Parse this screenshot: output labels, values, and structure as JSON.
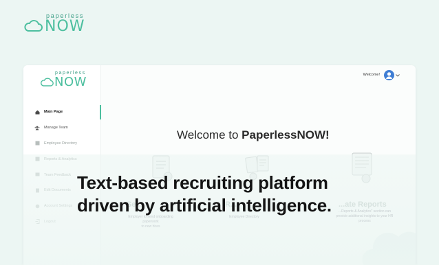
{
  "brand": {
    "small": "paperless",
    "big": "NOW"
  },
  "app": {
    "brand": {
      "small": "paperless",
      "big": "NOW"
    },
    "topbar": {
      "welcome": "Welcome!"
    },
    "nav": [
      {
        "label": "Main Page",
        "icon": "home-icon",
        "active": true
      },
      {
        "label": "Manage Team",
        "icon": "team-icon"
      },
      {
        "label": "Employee Directory",
        "icon": "directory-icon"
      },
      {
        "label": "Reports & Analytics",
        "icon": "reports-icon"
      },
      {
        "label": "Team Feedback",
        "icon": "feedback-icon"
      },
      {
        "label": "Edit Documents",
        "icon": "documents-icon"
      },
      {
        "label": "Account Settings",
        "icon": "settings-icon"
      },
      {
        "label": "Logout",
        "icon": "logout-icon"
      }
    ],
    "main": {
      "title_prefix": "Welcome to ",
      "title_brand": "PaperlessNOW!",
      "features": [
        {
          "title": "Se...",
          "desc_line1": "Employer to send onboarding paperwork",
          "desc_line2": "to new hires"
        },
        {
          "title": "R...",
          "desc_line1": "Employee Directory",
          "desc_line2": ""
        },
        {
          "title": "...ate Reports",
          "desc_line1": "...Reports & Analytics\" section can",
          "desc_line2": "provide additional insights to your HR",
          "desc_line3": "process"
        }
      ]
    }
  },
  "headline": {
    "line1": "Text-based recruiting platform",
    "line2": "driven by artificial intelligence."
  },
  "colors": {
    "accent": "#4dbf9f",
    "background": "#ecf6f3"
  }
}
